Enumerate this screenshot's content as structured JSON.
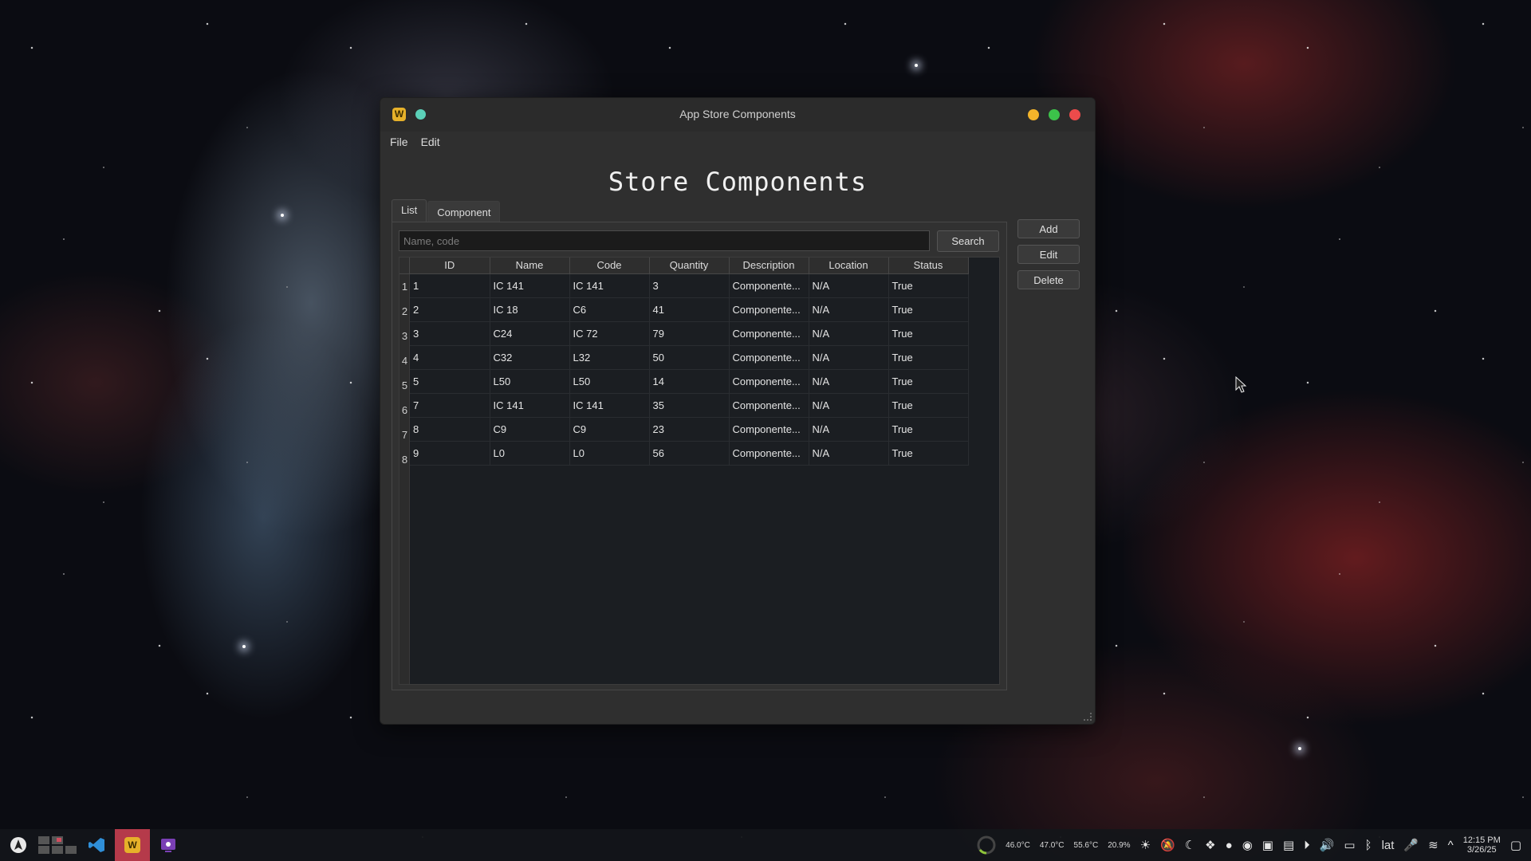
{
  "window": {
    "title": "App Store Components"
  },
  "menu": {
    "file": "File",
    "edit": "Edit"
  },
  "heading": "Store Components",
  "tabs": [
    {
      "label": "List"
    },
    {
      "label": "Component"
    }
  ],
  "search": {
    "placeholder": "Name, code",
    "value": "",
    "button": "Search"
  },
  "table": {
    "columns": [
      "ID",
      "Name",
      "Code",
      "Quantity",
      "Description",
      "Location",
      "Status"
    ],
    "rows": [
      {
        "num": "1",
        "cells": [
          "1",
          "IC 141",
          "IC 141",
          "3",
          "Componente...",
          "N/A",
          "True"
        ]
      },
      {
        "num": "2",
        "cells": [
          "2",
          "IC 18",
          "C6",
          "41",
          "Componente...",
          "N/A",
          "True"
        ]
      },
      {
        "num": "3",
        "cells": [
          "3",
          "C24",
          "IC 72",
          "79",
          "Componente...",
          "N/A",
          "True"
        ]
      },
      {
        "num": "4",
        "cells": [
          "4",
          "C32",
          "L32",
          "50",
          "Componente...",
          "N/A",
          "True"
        ]
      },
      {
        "num": "5",
        "cells": [
          "5",
          "L50",
          "L50",
          "14",
          "Componente...",
          "N/A",
          "True"
        ]
      },
      {
        "num": "6",
        "cells": [
          "7",
          "IC 141",
          "IC 141",
          "35",
          "Componente...",
          "N/A",
          "True"
        ]
      },
      {
        "num": "7",
        "cells": [
          "8",
          "C9",
          "C9",
          "23",
          "Componente...",
          "N/A",
          "True"
        ]
      },
      {
        "num": "8",
        "cells": [
          "9",
          "L0",
          "L0",
          "56",
          "Componente...",
          "N/A",
          "True"
        ]
      }
    ]
  },
  "actions": {
    "add": "Add",
    "edit": "Edit",
    "delete": "Delete"
  },
  "taskbar": {
    "temps": [
      "46.0°C",
      "47.0°C",
      "55.6°C",
      "20.9%"
    ],
    "keyboard_layout": "lat",
    "time": "12:15 PM",
    "date": "3/26/25"
  },
  "icons": {
    "app": "W",
    "colors": {
      "accent_active_task": "#b53a4a",
      "minimize": "#f3b42a",
      "maximize": "#3cc24a",
      "close": "#ec4b4b",
      "pin": "#5bd0b8"
    }
  }
}
